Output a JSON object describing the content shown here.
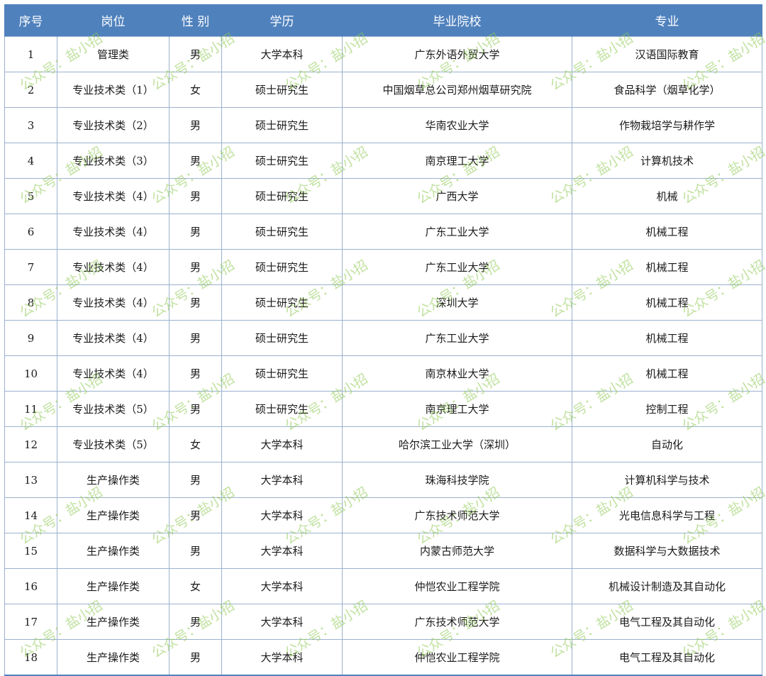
{
  "table": {
    "headers": [
      "序号",
      "岗位",
      "性 别",
      "学历",
      "毕业院校",
      "专业"
    ],
    "rows": [
      [
        "1",
        "管理类",
        "男",
        "大学本科",
        "广东外语外贸大学",
        "汉语国际教育"
      ],
      [
        "2",
        "专业技术类（1）",
        "女",
        "硕士研究生",
        "中国烟草总公司郑州烟草研究院",
        "食品科学（烟草化学）"
      ],
      [
        "3",
        "专业技术类（2）",
        "男",
        "硕士研究生",
        "华南农业大学",
        "作物栽培学与耕作学"
      ],
      [
        "4",
        "专业技术类（3）",
        "男",
        "硕士研究生",
        "南京理工大学",
        "计算机技术"
      ],
      [
        "5",
        "专业技术类（4）",
        "男",
        "硕士研究生",
        "广西大学",
        "机械"
      ],
      [
        "6",
        "专业技术类（4）",
        "男",
        "硕士研究生",
        "广东工业大学",
        "机械工程"
      ],
      [
        "7",
        "专业技术类（4）",
        "男",
        "硕士研究生",
        "广东工业大学",
        "机械工程"
      ],
      [
        "8",
        "专业技术类（4）",
        "男",
        "硕士研究生",
        "深圳大学",
        "机械工程"
      ],
      [
        "9",
        "专业技术类（4）",
        "男",
        "硕士研究生",
        "广东工业大学",
        "机械工程"
      ],
      [
        "10",
        "专业技术类（4）",
        "男",
        "硕士研究生",
        "南京林业大学",
        "机械工程"
      ],
      [
        "11",
        "专业技术类（5）",
        "男",
        "硕士研究生",
        "南京理工大学",
        "控制工程"
      ],
      [
        "12",
        "专业技术类（5）",
        "女",
        "大学本科",
        "哈尔滨工业大学（深圳）",
        "自动化"
      ],
      [
        "13",
        "生产操作类",
        "男",
        "大学本科",
        "珠海科技学院",
        "计算机科学与技术"
      ],
      [
        "14",
        "生产操作类",
        "男",
        "大学本科",
        "广东技术师范大学",
        "光电信息科学与工程"
      ],
      [
        "15",
        "生产操作类",
        "男",
        "大学本科",
        "内蒙古师范大学",
        "数据科学与大数据技术"
      ],
      [
        "16",
        "生产操作类",
        "女",
        "大学本科",
        "仲恺农业工程学院",
        "机械设计制造及其自动化"
      ],
      [
        "17",
        "生产操作类",
        "男",
        "大学本科",
        "广东技术师范大学",
        "电气工程及其自动化"
      ],
      [
        "18",
        "生产操作类",
        "男",
        "大学本科",
        "仲恺农业工程学院",
        "电气工程及其自动化"
      ]
    ]
  },
  "watermark": {
    "text": "公众号：盐小招"
  },
  "colors": {
    "header_bg": "#4f81bd",
    "header_text": "#ffffff",
    "grid_line": "#9bb1cf",
    "watermark": "#8cc850"
  }
}
